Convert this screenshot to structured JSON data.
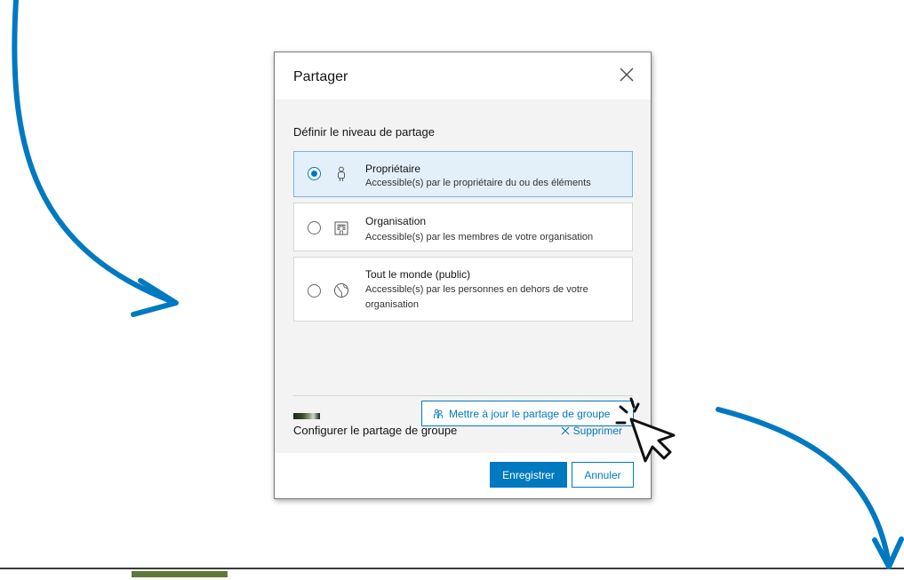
{
  "dialog": {
    "title": "Partager",
    "sharing_level_title": "Définir le niveau de partage",
    "options": [
      {
        "title": "Propriétaire",
        "desc": "Accessible(s) par le propriétaire du ou des éléments",
        "selected": true,
        "icon": "person-icon"
      },
      {
        "title": "Organisation",
        "desc": "Accessible(s) par les membres de votre organisation",
        "selected": false,
        "icon": "building-icon"
      },
      {
        "title": "Tout le monde (public)",
        "desc": "Accessible(s) par les personnes en dehors de votre organisation",
        "selected": false,
        "icon": "globe-icon"
      }
    ],
    "group_title": "Configurer le partage de groupe",
    "remove_label": "Supprimer",
    "update_group_label": "Mettre à jour le partage de groupe",
    "save_label": "Enregistrer",
    "cancel_label": "Annuler"
  },
  "colors": {
    "accent": "#0079c1",
    "arrow": "#0079c1",
    "selected_bg": "#e3f0f9",
    "body_bg": "#f3f3f3"
  }
}
